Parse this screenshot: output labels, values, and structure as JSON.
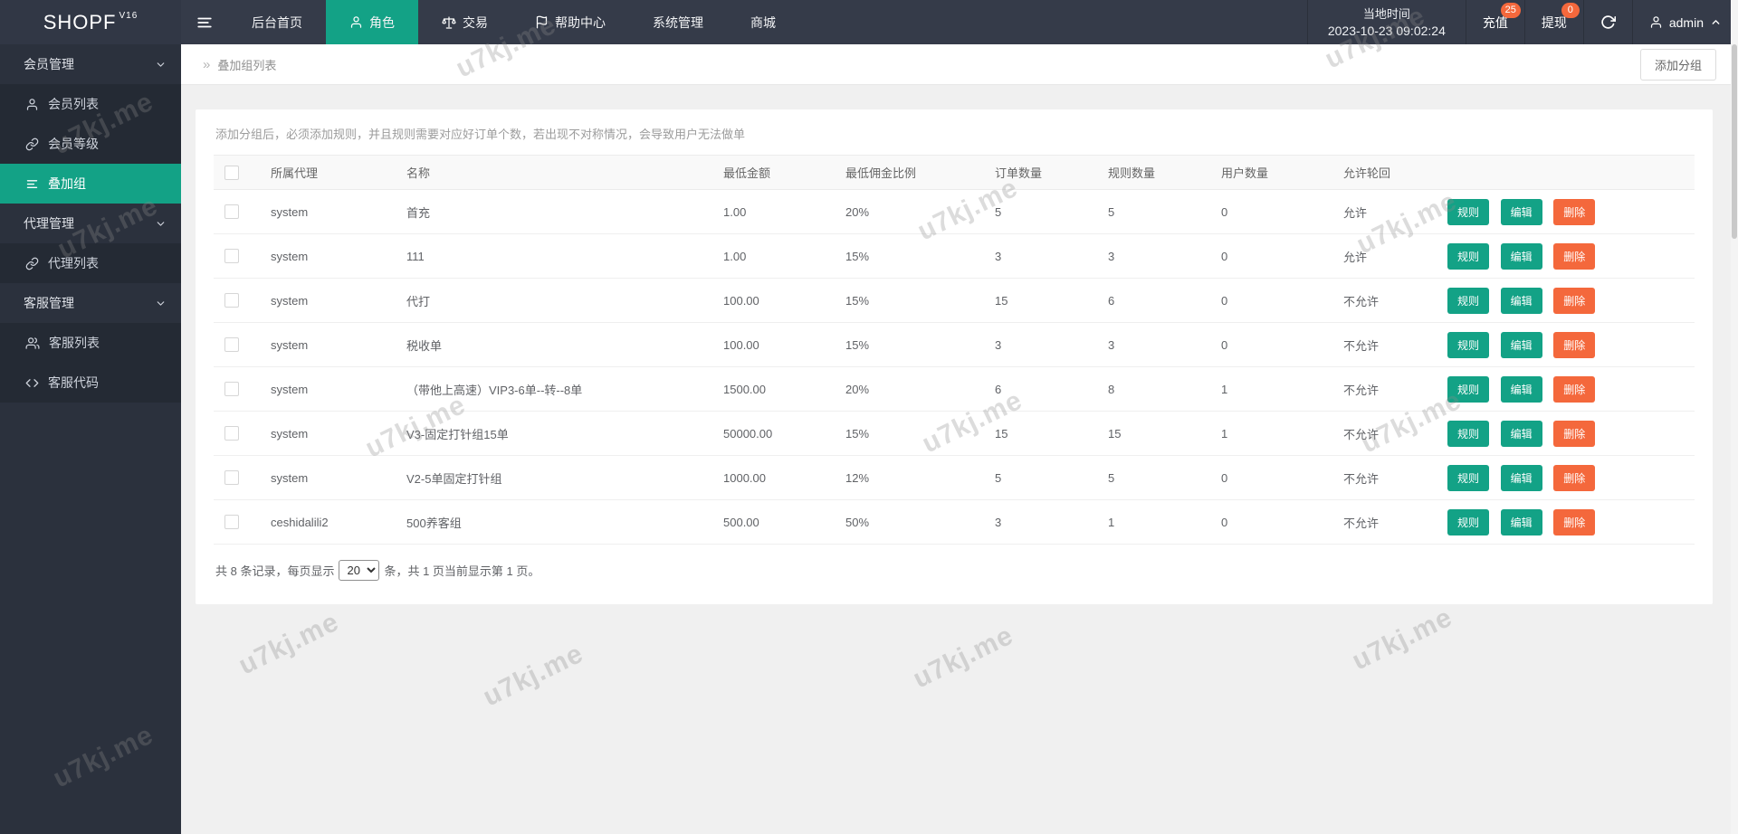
{
  "watermark": {
    "text": "u7kj.me"
  },
  "topbar": {
    "logo": "SHOPF",
    "logo_version": "V16",
    "nav": [
      {
        "label": "后台首页"
      },
      {
        "label": "角色"
      },
      {
        "label": "交易"
      },
      {
        "label": "帮助中心"
      },
      {
        "label": "系统管理"
      },
      {
        "label": "商城"
      }
    ],
    "local_time_label": "当地时间",
    "local_time_value": "2023-10-23 09:02:24",
    "recharge_label": "充值",
    "recharge_badge": "25",
    "withdraw_label": "提现",
    "withdraw_badge": "0",
    "username": "admin"
  },
  "sidebar": {
    "items": [
      {
        "label": "会员管理"
      },
      {
        "label": "会员列表"
      },
      {
        "label": "会员等级"
      },
      {
        "label": "叠加组"
      },
      {
        "label": "代理管理"
      },
      {
        "label": "代理列表"
      },
      {
        "label": "客服管理"
      },
      {
        "label": "客服列表"
      },
      {
        "label": "客服代码"
      }
    ]
  },
  "breadcrumb": {
    "title": "叠加组列表",
    "add_button": "添加分组"
  },
  "notice": "添加分组后，必须添加规则，并且规则需要对应好订单个数，若出现不对称情况，会导致用户无法做单",
  "table": {
    "headers": [
      "所属代理",
      "名称",
      "最低金额",
      "最低佣金比例",
      "订单数量",
      "规则数量",
      "用户数量",
      "允许轮回"
    ],
    "action_buttons": [
      "规则",
      "编辑",
      "删除"
    ],
    "rows": [
      {
        "agent": "system",
        "name": "首充",
        "min_amount": "1.00",
        "min_commission": "20%",
        "orders": "5",
        "rules": "5",
        "users": "0",
        "loop": "允许"
      },
      {
        "agent": "system",
        "name": "111",
        "min_amount": "1.00",
        "min_commission": "15%",
        "orders": "3",
        "rules": "3",
        "users": "0",
        "loop": "允许"
      },
      {
        "agent": "system",
        "name": "代打",
        "min_amount": "100.00",
        "min_commission": "15%",
        "orders": "15",
        "rules": "6",
        "users": "0",
        "loop": "不允许"
      },
      {
        "agent": "system",
        "name": "税收单",
        "min_amount": "100.00",
        "min_commission": "15%",
        "orders": "3",
        "rules": "3",
        "users": "0",
        "loop": "不允许"
      },
      {
        "agent": "system",
        "name": "（带他上高速）VIP3-6单--转--8单",
        "min_amount": "1500.00",
        "min_commission": "20%",
        "orders": "6",
        "rules": "8",
        "users": "1",
        "loop": "不允许"
      },
      {
        "agent": "system",
        "name": "V3-固定打针组15单",
        "min_amount": "50000.00",
        "min_commission": "15%",
        "orders": "15",
        "rules": "15",
        "users": "1",
        "loop": "不允许"
      },
      {
        "agent": "system",
        "name": "V2-5单固定打针组",
        "min_amount": "1000.00",
        "min_commission": "12%",
        "orders": "5",
        "rules": "5",
        "users": "0",
        "loop": "不允许"
      },
      {
        "agent": "ceshidalili2",
        "name": "500养客组",
        "min_amount": "500.00",
        "min_commission": "50%",
        "orders": "3",
        "rules": "1",
        "users": "0",
        "loop": "不允许"
      }
    ]
  },
  "pagination": {
    "prefix": "共 8 条记录，每页显示",
    "per_page": "20",
    "suffix": "条，共 1 页当前显示第 1 页。"
  },
  "colors": {
    "accent_teal": "#13a286",
    "accent_orange": "#f4683c",
    "topbar_bg": "#353b49",
    "sidebar_bg": "#2b313d"
  }
}
